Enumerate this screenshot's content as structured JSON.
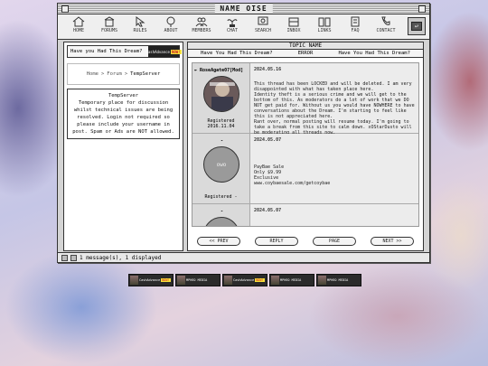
{
  "window": {
    "title": "NAME OISE"
  },
  "toolbar": {
    "items": [
      {
        "label": "HOME",
        "icon": "home-icon"
      },
      {
        "label": "FORUMS",
        "icon": "house-icon"
      },
      {
        "label": "RULES",
        "icon": "cursor-icon"
      },
      {
        "label": "ABOUT",
        "icon": "tree-icon"
      },
      {
        "label": "MEMBERS",
        "icon": "people-icon"
      },
      {
        "label": "CHAT",
        "icon": "plant-icon"
      },
      {
        "label": "SEARCH",
        "icon": "magnifier-icon"
      },
      {
        "label": "INBOX",
        "icon": "mailbox-icon"
      },
      {
        "label": "LINKS",
        "icon": "book-icon"
      },
      {
        "label": "FAQ",
        "icon": "note-icon"
      },
      {
        "label": "CONTACT",
        "icon": "phone-icon"
      }
    ]
  },
  "sidebar": {
    "header": "Have you Had This Dream?",
    "ad_label": "CashAdvance",
    "ad_badge": "NOW!",
    "breadcrumb": {
      "home": "Home",
      "sep1": ">",
      "forum": "Forum",
      "sep2": ">",
      "current": "TempServer"
    },
    "desc_title": "TempServer",
    "desc_text": "Temporary place for discussion whilst technical issues are being resolved. Login not required so please include your username in post. Spam or Ads are NOT allowed."
  },
  "thread": {
    "header": "TOPIC NAME",
    "sub": [
      "Have You Had This Dream?",
      "ERROR",
      "Have You Had This Dream?"
    ],
    "posts": [
      {
        "username": "RoseAgate07[Mod]",
        "date": "2024.05.16",
        "registered": "Registered 2016.11.04",
        "body": [
          "This thread has been LOCKED and will be deleted. I am very disappointed with what has taken place here.",
          "Identity theft is a serious crime and we will get to the bottom of this. As moderators do a lot of work that we DO NOT get paid for. Without us you would have NOWHERE to have conversations about the Dream. I'm starting to feel like this is not appreciated here.",
          "Rant over, normal posting will resume today. I'm going to take a break from this site to calm down. xOStarDusto will be moderating all threads now."
        ]
      },
      {
        "username": "-",
        "date": "2024.05.07",
        "registered": "Registered -",
        "avatar_text": "owo",
        "body": [
          "PayBae Sale",
          "Only $9.99",
          "Exclusive",
          "www.coybaesale.com/getcoybae"
        ]
      },
      {
        "username": "-",
        "date": "2024.05.07",
        "registered": "",
        "avatar_text": "",
        "body": []
      }
    ],
    "nav": [
      "<< PREV",
      "REPLY",
      "PAGE",
      "NEXT >>"
    ]
  },
  "status": {
    "text": "1 message(s), 1 displayed"
  },
  "banners": [
    {
      "text": "CashAdvance",
      "badge": "NOW!"
    },
    {
      "text": "MPHEO MEDIA",
      "badge": ""
    },
    {
      "text": "CashAdvance",
      "badge": "NOW!"
    },
    {
      "text": "MPHEO MEDIA",
      "badge": ""
    },
    {
      "text": "MPHEO MEDIA",
      "badge": ""
    }
  ]
}
